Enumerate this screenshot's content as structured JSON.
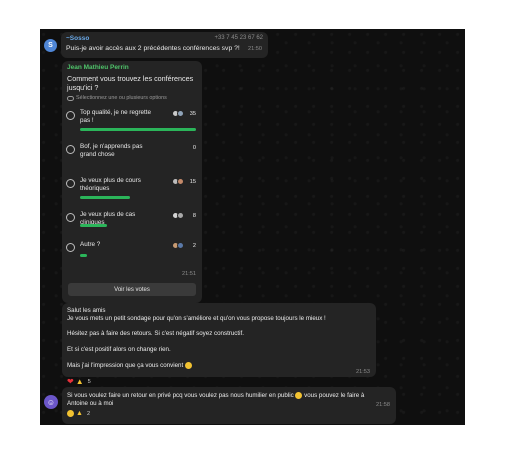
{
  "colors": {
    "background": "#0f0f0f",
    "bubble": "#242424",
    "poll_fill": "#2bb55a",
    "sender_name": "#6aa9e8",
    "poll_author": "#4fc36a"
  },
  "message1": {
    "avatar_letter": "S",
    "sender": "~Sosso",
    "phone": "+33 7 45 23 67 62",
    "text": "Puis-je avoir accès aux 2 précédentes conférences svp ?!",
    "time": "21:50"
  },
  "poll": {
    "author": "Jean Mathieu Perrin",
    "question": "Comment vous trouvez les conférences jusqu'ici ?",
    "hint": "Sélectionnez une ou plusieurs options",
    "options": [
      {
        "label": "Top qualité, je ne regrette pas !",
        "count": "35",
        "percent": 100
      },
      {
        "label": "Bof, je n'apprends pas grand chose",
        "count": "0",
        "percent": 0
      },
      {
        "label": "Je veux plus de cours théoriques",
        "count": "15",
        "percent": 43
      },
      {
        "label": "Je veux plus de cas cliniques",
        "count": "8",
        "percent": 23
      },
      {
        "label": "Autre ?",
        "count": "2",
        "percent": 6
      }
    ],
    "time": "21:51",
    "votes_button": "Voir les votes"
  },
  "message3": {
    "lines": [
      "Salut les amis",
      "Je vous mets un petit sondage pour qu'on s'améliore et qu'on vous propose toujours le mieux !",
      "Hésitez pas à faire des retours. Si c'est négatif soyez constructif.",
      "Et si c'est positif alors on change rien.",
      "Mais j'ai l'impression que ça vous convient"
    ],
    "time": "21:53",
    "reactions": {
      "emojis": [
        "red-heart",
        "thumbs-up"
      ],
      "count": "5"
    }
  },
  "message4": {
    "text": "Si vous voulez faire un retour en privé pcq vous voulez pas nous humilier en public",
    "text2": "vous pouvez le faire à Antoine ou à moi",
    "time": "21:58",
    "reactions": {
      "emojis": [
        "grinning-face",
        "folded-hands"
      ],
      "count": "2"
    }
  }
}
